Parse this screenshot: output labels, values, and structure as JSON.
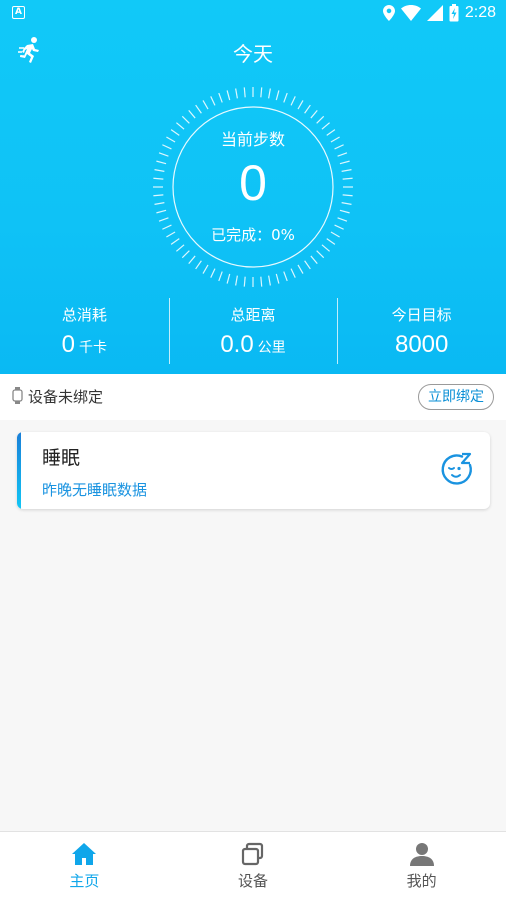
{
  "status_bar": {
    "time": "2:28",
    "badge": "A"
  },
  "header": {
    "title": "今天"
  },
  "dial": {
    "label": "当前步数",
    "steps": "0",
    "completion": "已完成：0%"
  },
  "stats": [
    {
      "label": "总消耗",
      "value": "0",
      "unit": "千卡"
    },
    {
      "label": "总距离",
      "value": "0.0",
      "unit": "公里"
    },
    {
      "label": "今日目标",
      "value": "8000",
      "unit": ""
    }
  ],
  "device": {
    "status": "设备未绑定",
    "bind_label": "立即绑定"
  },
  "sleep_card": {
    "title": "睡眠",
    "subtitle": "昨晚无睡眠数据"
  },
  "nav": [
    {
      "label": "主页",
      "icon": "home-icon",
      "active": true
    },
    {
      "label": "设备",
      "icon": "device-icon",
      "active": false
    },
    {
      "label": "我的",
      "icon": "profile-icon",
      "active": false
    }
  ],
  "colors": {
    "primary": "#0fc2f6",
    "accent_text": "#1a93e0",
    "active_nav": "#0fa6ea"
  }
}
